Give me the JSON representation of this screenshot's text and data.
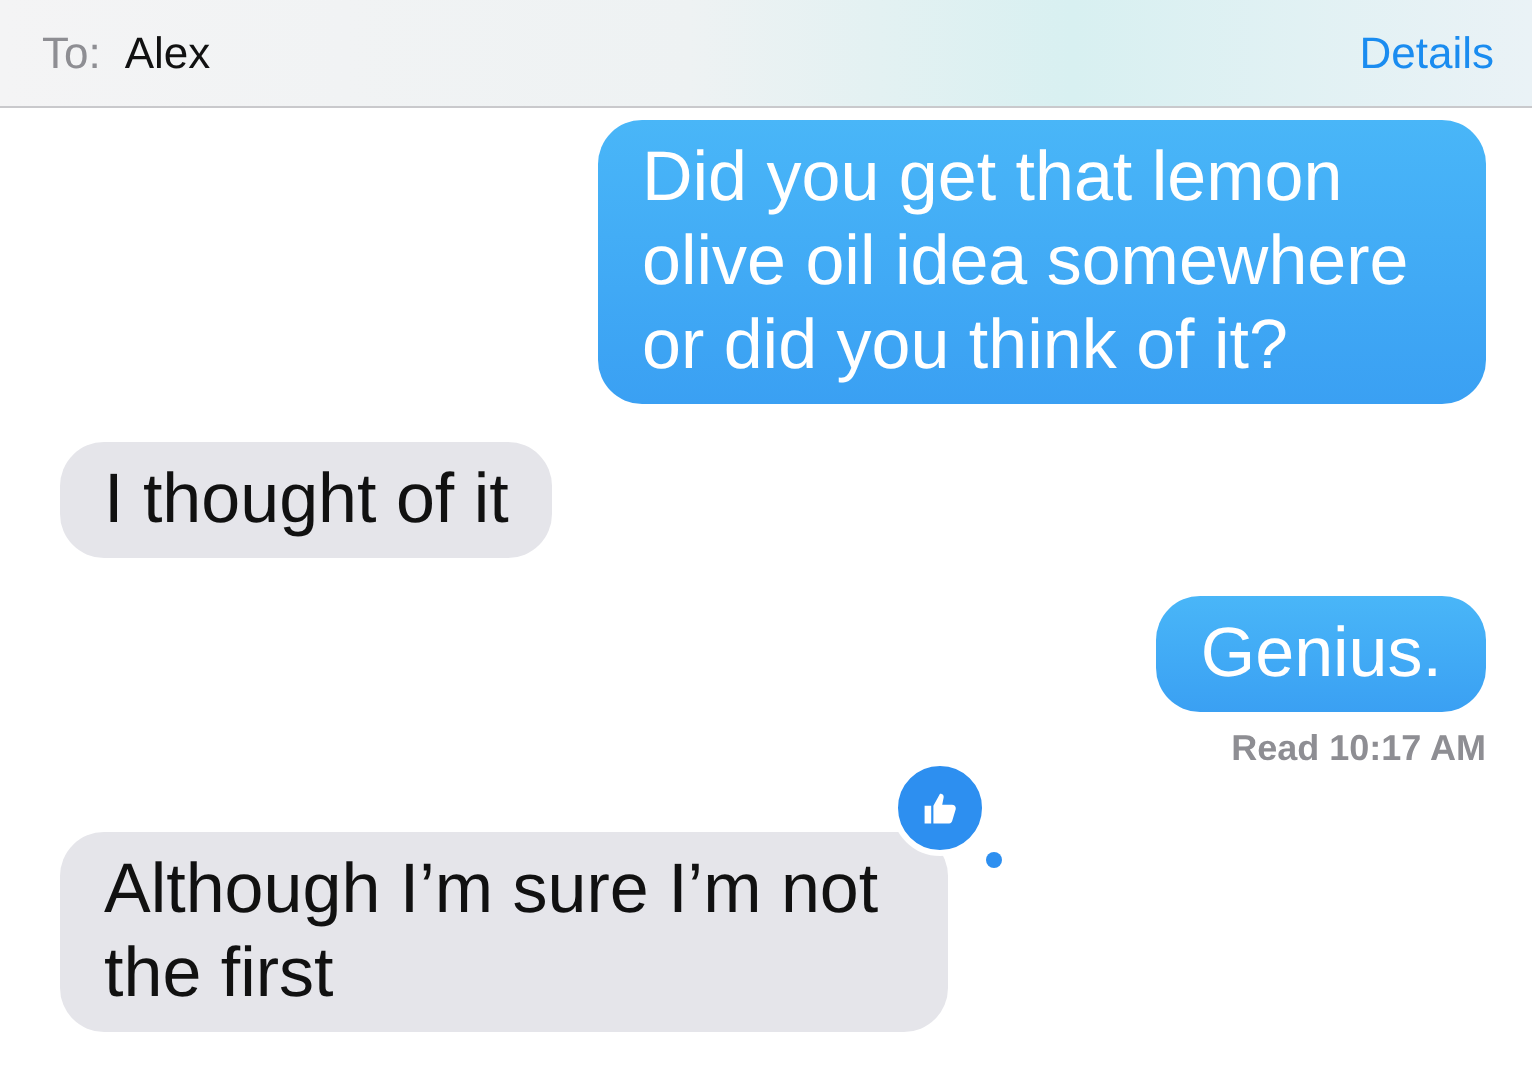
{
  "header": {
    "to_label": "To:",
    "recipient": "Alex",
    "details": "Details"
  },
  "messages": [
    {
      "kind": "sent",
      "text": "Did you get that lemon olive oil idea somewhere or did you think of it?"
    },
    {
      "kind": "received",
      "text": "I thought of it"
    },
    {
      "kind": "sent",
      "text": "Genius.",
      "receipt": "Read 10:17 AM"
    },
    {
      "kind": "received",
      "text": "Although I’m sure I’m not the first",
      "liked": true
    }
  ]
}
